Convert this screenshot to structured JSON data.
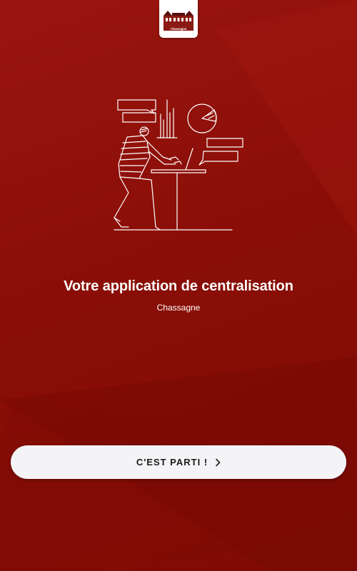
{
  "logo": {
    "brand_text": "Chassagne"
  },
  "main": {
    "headline": "Votre application de centralisation",
    "subtitle": "Chassagne"
  },
  "cta": {
    "label": "C'EST PARTI !",
    "icon": "chevron-right-icon"
  },
  "colors": {
    "background": "#8e0f08",
    "button_background": "#f4f4f7",
    "button_text": "#1b1b1b",
    "text": "#ffffff"
  }
}
